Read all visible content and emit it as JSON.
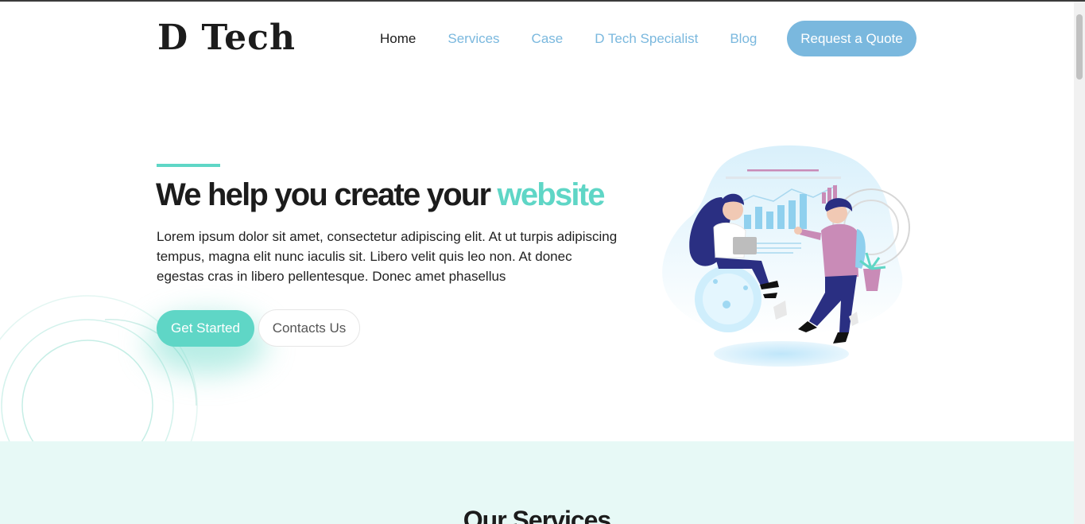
{
  "brand": {
    "name": "D Tech"
  },
  "nav": {
    "items": [
      {
        "label": "Home",
        "active": true
      },
      {
        "label": "Services",
        "active": false
      },
      {
        "label": "Case",
        "active": false
      },
      {
        "label": "D Tech Specialist",
        "active": false
      },
      {
        "label": "Blog",
        "active": false
      }
    ],
    "cta_label": "Request a Quote"
  },
  "hero": {
    "title_main": "We help you create your ",
    "title_highlight": "website",
    "description": "Lorem ipsum dolor sit amet, consectetur adipiscing elit. At ut turpis adipiscing tempus, magna elit nunc iaculis sit. Libero velit quis leo non. At donec egestas cras in libero pellentesque. Donec amet phasellus",
    "primary_button": "Get Started",
    "secondary_button": "Contacts Us",
    "illustration_icon": "team-analytics-illustration"
  },
  "services": {
    "title": "Our Services"
  },
  "colors": {
    "accent": "#5fd6c6",
    "brand_blue": "#7ab8de",
    "section_bg": "#e7f9f6",
    "text_dark": "#1c1c1c"
  }
}
